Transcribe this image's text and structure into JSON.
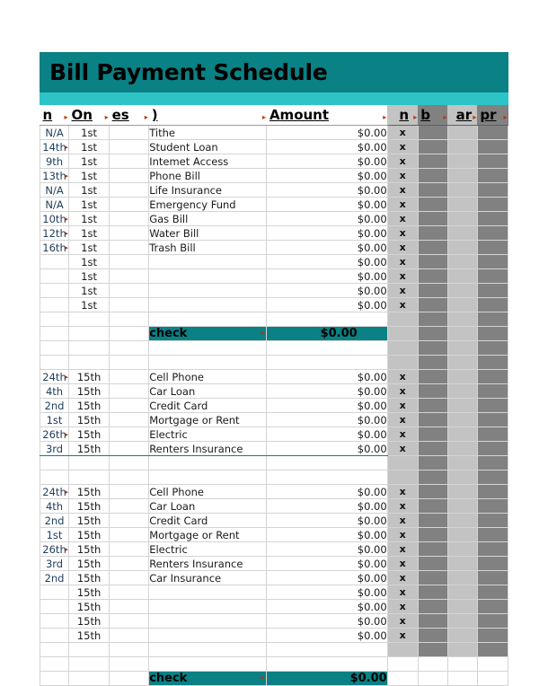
{
  "document": {
    "title": "Bill Payment Schedule",
    "accent_color": "#0a8184",
    "accent_light_color": "#2cc4c6",
    "marker_light_color": "#c3c3c3",
    "marker_dark_color": "#818181"
  },
  "headers": {
    "due": "n",
    "on": "On",
    "es": "es",
    "name": ")",
    "amount": "Amount",
    "gray1": "n",
    "gray2": "b",
    "gray3": "ar",
    "gray4": "pr",
    "overflow_marker": "▸"
  },
  "sections": [
    {
      "name": "first-of-month",
      "rows": [
        {
          "due": "N/A",
          "due_overflow": false,
          "on": "1st",
          "es": "",
          "name": "Tithe",
          "amount": "$0.00",
          "mark": "x"
        },
        {
          "due": "14th",
          "due_overflow": true,
          "on": "1st",
          "es": "",
          "name": "Student Loan",
          "amount": "$0.00",
          "mark": "x"
        },
        {
          "due": "9th",
          "due_overflow": false,
          "on": "1st",
          "es": "",
          "name": "Intemet Access",
          "amount": "$0.00",
          "mark": "x"
        },
        {
          "due": "13th",
          "due_overflow": true,
          "on": "1st",
          "es": "",
          "name": "Phone Bill",
          "amount": "$0.00",
          "mark": "x"
        },
        {
          "due": "N/A",
          "due_overflow": false,
          "on": "1st",
          "es": "",
          "name": "Life Insurance",
          "amount": "$0.00",
          "mark": "x"
        },
        {
          "due": "N/A",
          "due_overflow": false,
          "on": "1st",
          "es": "",
          "name": "Emergency Fund",
          "amount": "$0.00",
          "mark": "x"
        },
        {
          "due": "10th",
          "due_overflow": true,
          "on": "1st",
          "es": "",
          "name": "Gas Bill",
          "amount": "$0.00",
          "mark": "x"
        },
        {
          "due": "12th",
          "due_overflow": true,
          "on": "1st",
          "es": "",
          "name": "Water Bill",
          "amount": "$0.00",
          "mark": "x"
        },
        {
          "due": "16th",
          "due_overflow": true,
          "on": "1st",
          "es": "",
          "name": "Trash Bill",
          "amount": "$0.00",
          "mark": "x"
        },
        {
          "due": "",
          "due_overflow": false,
          "on": "1st",
          "es": "",
          "name": "",
          "amount": "$0.00",
          "mark": "x"
        },
        {
          "due": "",
          "due_overflow": false,
          "on": "1st",
          "es": "",
          "name": "",
          "amount": "$0.00",
          "mark": "x"
        },
        {
          "due": "",
          "due_overflow": false,
          "on": "1st",
          "es": "",
          "name": "",
          "amount": "$0.00",
          "mark": "x"
        },
        {
          "due": "",
          "due_overflow": false,
          "on": "1st",
          "es": "",
          "name": "",
          "amount": "$0.00",
          "mark": "x"
        }
      ],
      "total": {
        "label": "check",
        "amount": "$0.00"
      }
    },
    {
      "name": "fifteenth-block-one",
      "rows": [
        {
          "due": "24th",
          "due_overflow": true,
          "on": "15th",
          "es": "",
          "name": "Cell Phone",
          "amount": "$0.00",
          "mark": "x"
        },
        {
          "due": "4th",
          "due_overflow": false,
          "on": "15th",
          "es": "",
          "name": "Car Loan",
          "amount": "$0.00",
          "mark": "x"
        },
        {
          "due": "2nd",
          "due_overflow": false,
          "on": "15th",
          "es": "",
          "name": "Credit Card",
          "amount": "$0.00",
          "mark": "x"
        },
        {
          "due": "1st",
          "due_overflow": false,
          "on": "15th",
          "es": "",
          "name": "Mortgage or Rent",
          "amount": "$0.00",
          "mark": "x"
        },
        {
          "due": "26th",
          "due_overflow": true,
          "on": "15th",
          "es": "",
          "name": "Electric",
          "amount": "$0.00",
          "mark": "x"
        },
        {
          "due": "3rd",
          "due_overflow": false,
          "on": "15th",
          "es": "",
          "name": "Renters Insurance",
          "amount": "$0.00",
          "mark": "x"
        }
      ],
      "total": null
    },
    {
      "name": "fifteenth-block-two",
      "rows": [
        {
          "due": "24th",
          "due_overflow": true,
          "on": "15th",
          "es": "",
          "name": "Cell Phone",
          "amount": "$0.00",
          "mark": "x"
        },
        {
          "due": "4th",
          "due_overflow": false,
          "on": "15th",
          "es": "",
          "name": "Car Loan",
          "amount": "$0.00",
          "mark": "x"
        },
        {
          "due": "2nd",
          "due_overflow": false,
          "on": "15th",
          "es": "",
          "name": "Credit Card",
          "amount": "$0.00",
          "mark": "x"
        },
        {
          "due": "1st",
          "due_overflow": false,
          "on": "15th",
          "es": "",
          "name": "Mortgage or Rent",
          "amount": "$0.00",
          "mark": "x"
        },
        {
          "due": "26th",
          "due_overflow": true,
          "on": "15th",
          "es": "",
          "name": "Electric",
          "amount": "$0.00",
          "mark": "x"
        },
        {
          "due": "3rd",
          "due_overflow": false,
          "on": "15th",
          "es": "",
          "name": "Renters Insurance",
          "amount": "$0.00",
          "mark": "x"
        },
        {
          "due": "2nd",
          "due_overflow": false,
          "on": "15th",
          "es": "",
          "name": "Car Insurance",
          "amount": "$0.00",
          "mark": "x"
        },
        {
          "due": "",
          "due_overflow": false,
          "on": "15th",
          "es": "",
          "name": "",
          "amount": "$0.00",
          "mark": "x"
        },
        {
          "due": "",
          "due_overflow": false,
          "on": "15th",
          "es": "",
          "name": "",
          "amount": "$0.00",
          "mark": "x"
        },
        {
          "due": "",
          "due_overflow": false,
          "on": "15th",
          "es": "",
          "name": "",
          "amount": "$0.00",
          "mark": "x"
        },
        {
          "due": "",
          "due_overflow": false,
          "on": "15th",
          "es": "",
          "name": "",
          "amount": "$0.00",
          "mark": "x"
        }
      ],
      "total": {
        "label": "check",
        "amount": "$0.00"
      }
    }
  ]
}
